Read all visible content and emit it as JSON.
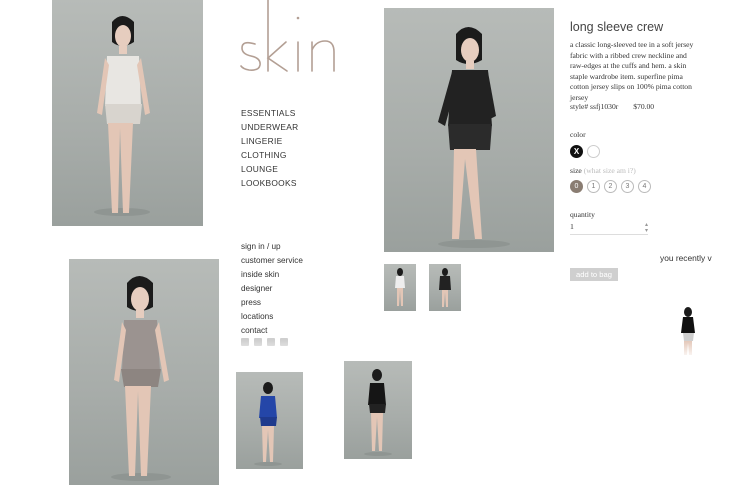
{
  "brand": {
    "logo_text": "skin"
  },
  "nav_main": [
    "ESSENTIALS",
    "UNDERWEAR",
    "LINGERIE",
    "CLOTHING",
    "LOUNGE",
    "LOOKBOOKS"
  ],
  "nav_secondary": [
    "sign in / up",
    "customer service",
    "inside skin",
    "designer",
    "press",
    "locations",
    "contact"
  ],
  "social_icons": [
    "facebook-icon",
    "twitter-icon",
    "pinterest-icon",
    "email-icon"
  ],
  "product": {
    "title": "long sleeve crew",
    "description": "a classic long-sleeved tee in a soft jersey fabric with a ribbed crew neckline and raw-edges at the cuffs and hem. a skin staple wardrobe item. superfine pima cotton jersey slips on 100% pima cotton jersey",
    "style": "style# ssfj1030r",
    "price": "$70.00",
    "color_label": "color",
    "colors": [
      {
        "name": "black",
        "hex": "#111111",
        "selected": true,
        "mark": "X"
      },
      {
        "name": "white",
        "hex": "#ffffff",
        "selected": false,
        "mark": ""
      }
    ],
    "size_label": "size",
    "size_help": "(what size am i?)",
    "sizes": [
      "0",
      "1",
      "2",
      "3",
      "4"
    ],
    "selected_size": "0",
    "quantity_label": "quantity",
    "quantity": "1",
    "add_to_bag": "add to bag"
  },
  "recently_viewed_label": "you recently v",
  "colors": {
    "accent": "#8a7d72",
    "photo_bg": "#a9aeab",
    "button_bg": "#cfcfcf"
  }
}
